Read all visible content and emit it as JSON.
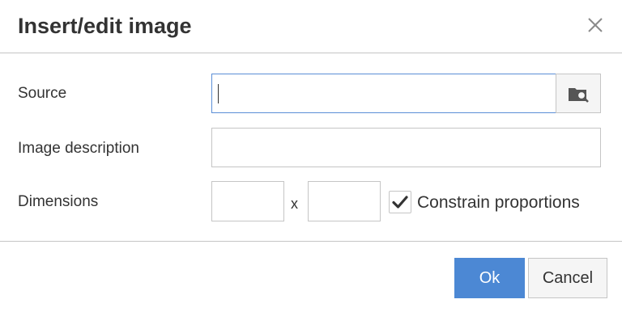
{
  "dialog": {
    "title": "Insert/edit image",
    "close_icon": "close-icon"
  },
  "form": {
    "source": {
      "label": "Source",
      "value": "",
      "browse_icon": "browse-image-icon"
    },
    "description": {
      "label": "Image description",
      "value": ""
    },
    "dimensions": {
      "label": "Dimensions",
      "width": "",
      "height": "",
      "separator": "x",
      "constrain_label": "Constrain proportions",
      "constrain_checked": true
    }
  },
  "footer": {
    "ok_label": "Ok",
    "cancel_label": "Cancel"
  },
  "colors": {
    "primary": "#4c88d4",
    "focus_border": "#5b8ed6",
    "border": "#c5c5c5",
    "text": "#333333"
  }
}
